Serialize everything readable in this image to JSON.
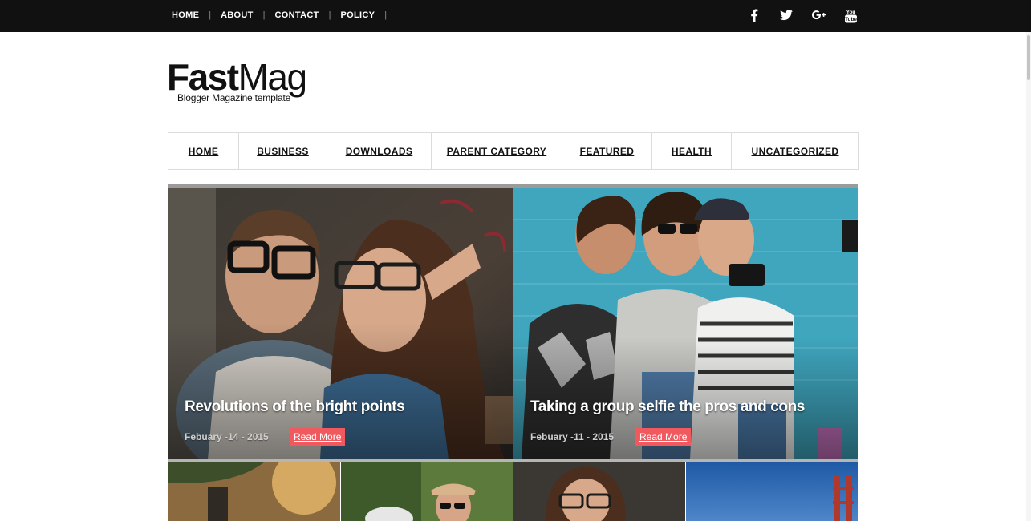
{
  "topbar": {
    "nav": [
      "HOME",
      "ABOUT",
      "CONTACT",
      "POLICY"
    ],
    "separator": "|",
    "social": [
      "facebook-icon",
      "twitter-icon",
      "google-plus-icon",
      "youtube-icon"
    ],
    "youtube_text": "You Tube"
  },
  "logo": {
    "part1": "Fast",
    "part2": "Mag",
    "tagline": "Blogger Magazine template"
  },
  "mainnav": [
    "HOME",
    "BUSINESS",
    "DOWNLOADS",
    "PARENT CATEGORY",
    "FEATURED",
    "HEALTH",
    "UNCATEGORIZED"
  ],
  "featured": [
    {
      "title": "Revolutions of the bright points",
      "date": "Febuary -14 - 2015",
      "read_more": "Read More"
    },
    {
      "title": "Taking a group selfie the pros and cons",
      "date": "Febuary -11 - 2015",
      "read_more": "Read More"
    }
  ],
  "colors": {
    "topbar": "#111111",
    "accent": "#f05a5f"
  }
}
